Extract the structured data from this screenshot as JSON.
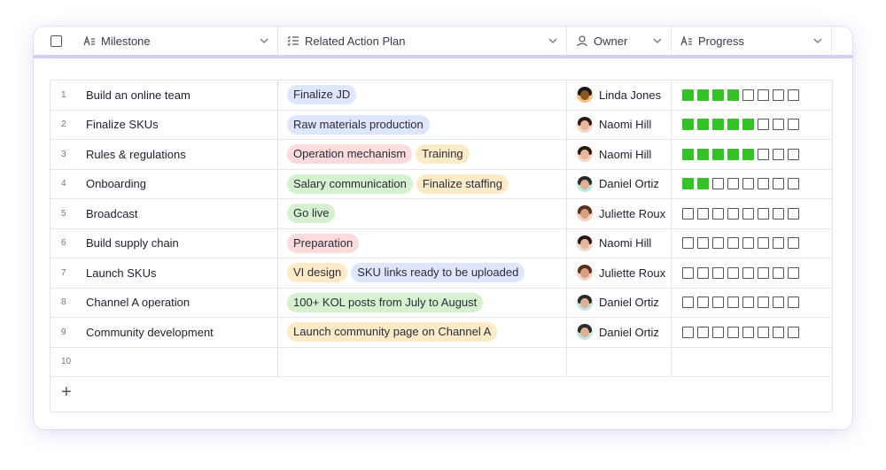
{
  "header": {
    "milestone": "Milestone",
    "plan": "Related Action Plan",
    "owner": "Owner",
    "progress": "Progress"
  },
  "colors": {
    "progress_on": "#32c325",
    "header_underline": "#d9cef6",
    "tag_blue": "#dde6fb",
    "tag_red": "#fbdcdc",
    "tag_yellow": "#fcebc6",
    "tag_green": "#d6f1cf"
  },
  "progress_total": 8,
  "rows": [
    {
      "num": "1",
      "milestone": "Build an online team",
      "tags": [
        {
          "text": "Finalize JD",
          "color": "blue"
        }
      ],
      "owner": "Linda Jones",
      "avatar": "linda",
      "progress": 4
    },
    {
      "num": "2",
      "milestone": "Finalize SKUs",
      "tags": [
        {
          "text": "Raw materials production",
          "color": "blue"
        }
      ],
      "owner": "Naomi Hill",
      "avatar": "naomi",
      "progress": 5
    },
    {
      "num": "3",
      "milestone": "Rules & regulations",
      "tags": [
        {
          "text": "Operation mechanism",
          "color": "red"
        },
        {
          "text": "Training",
          "color": "yellow"
        }
      ],
      "owner": "Naomi Hill",
      "avatar": "naomi",
      "progress": 5
    },
    {
      "num": "4",
      "milestone": "Onboarding",
      "tags": [
        {
          "text": "Salary communication",
          "color": "green"
        },
        {
          "text": "Finalize staffing",
          "color": "yellow"
        }
      ],
      "owner": "Daniel Ortiz",
      "avatar": "daniel",
      "progress": 2
    },
    {
      "num": "5",
      "milestone": "Broadcast",
      "tags": [
        {
          "text": "Go live",
          "color": "green"
        }
      ],
      "owner": "Juliette Roux",
      "avatar": "juliette",
      "progress": 0
    },
    {
      "num": "6",
      "milestone": "Build supply chain",
      "tags": [
        {
          "text": "Preparation",
          "color": "red"
        }
      ],
      "owner": "Naomi Hill",
      "avatar": "naomi",
      "progress": 0
    },
    {
      "num": "7",
      "milestone": "Launch SKUs",
      "tags": [
        {
          "text": "VI design",
          "color": "yellow"
        },
        {
          "text": "SKU links ready to be uploaded",
          "color": "blue"
        }
      ],
      "owner": "Juliette Roux",
      "avatar": "juliette",
      "progress": 0
    },
    {
      "num": "8",
      "milestone": "Channel A operation",
      "tags": [
        {
          "text": "100+ KOL posts from July to August",
          "color": "green"
        }
      ],
      "owner": "Daniel Ortiz",
      "avatar": "daniel",
      "progress": 0
    },
    {
      "num": "9",
      "milestone": "Community development",
      "tags": [
        {
          "text": "Launch community page on Channel A",
          "color": "yellow"
        }
      ],
      "owner": "Daniel Ortiz",
      "avatar": "daniel",
      "progress": 0
    },
    {
      "num": "10",
      "milestone": "",
      "tags": [],
      "owner": "",
      "avatar": "",
      "progress": null
    }
  ],
  "add_row_label": "+"
}
